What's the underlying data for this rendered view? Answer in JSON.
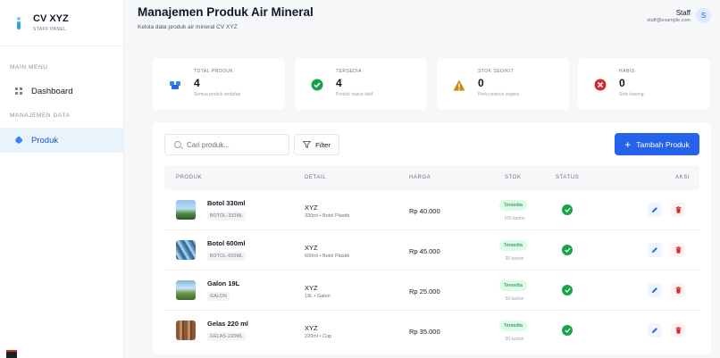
{
  "brand": {
    "name": "CV XYZ",
    "subtitle": "STAFF PANEL"
  },
  "sidebar": {
    "main_menu_label": "MAIN MENU",
    "data_label": "MANAJEMEN DATA",
    "items": [
      {
        "label": "Dashboard",
        "icon": "dashboard-grid-icon",
        "active": false
      },
      {
        "label": "Produk",
        "icon": "box-icon",
        "active": true
      }
    ]
  },
  "header": {
    "title": "Manajemen Produk Air Mineral",
    "subtitle": "Kelola data produk air mineral CV XYZ"
  },
  "user": {
    "name": "Staff",
    "email": "staff@example.com",
    "initial": "S"
  },
  "stats": [
    {
      "label": "TOTAL PRODUK",
      "value": "4",
      "desc": "Semua produk terdaftar",
      "icon": "boxes-icon",
      "color": "#3b82f6"
    },
    {
      "label": "TERSEDIA",
      "value": "4",
      "desc": "Produk status aktif",
      "icon": "check-circle-icon",
      "color": "#16a34a"
    },
    {
      "label": "STOK SEDIKIT",
      "value": "0",
      "desc": "Perlu restock segera",
      "icon": "warning-icon",
      "color": "#ca8a04"
    },
    {
      "label": "HABIS",
      "value": "0",
      "desc": "Stok kosong",
      "icon": "x-circle-icon",
      "color": "#dc2626"
    }
  ],
  "toolbar": {
    "search_placeholder": "Cari produk...",
    "filter_label": "Filter",
    "add_label": "Tambah Produk"
  },
  "table": {
    "columns": [
      "PRODUK",
      "DETAIL",
      "HARGA",
      "STOK",
      "STATUS",
      "AKSI"
    ],
    "rows": [
      {
        "name": "Botol 330ml",
        "sku": "BOTOL-330ML",
        "brand": "XYZ",
        "detail": "330ml • Botol Plastik",
        "price": "Rp 40.000",
        "badge": "Tersedia",
        "stock": "100 karton"
      },
      {
        "name": "Botol 600ml",
        "sku": "BOTOL-600ML",
        "brand": "XYZ",
        "detail": "600ml • Botol Plastik",
        "price": "Rp 45.000",
        "badge": "Tersedia",
        "stock": "90 karton"
      },
      {
        "name": "Galon 19L",
        "sku": "GALON",
        "brand": "XYZ",
        "detail": "19L • Galon",
        "price": "Rp 25.000",
        "badge": "Tersedia",
        "stock": "50 karton"
      },
      {
        "name": "Gelas 220 ml",
        "sku": "GELAS-220ML",
        "brand": "XYZ",
        "detail": "220ml • Cup",
        "price": "Rp 35.000",
        "badge": "Tersedia",
        "stock": "90 karton"
      }
    ]
  },
  "colors": {
    "accent": "#2563eb",
    "success": "#16a34a",
    "danger": "#dc2626",
    "active_bg": "#e9f3fb"
  }
}
